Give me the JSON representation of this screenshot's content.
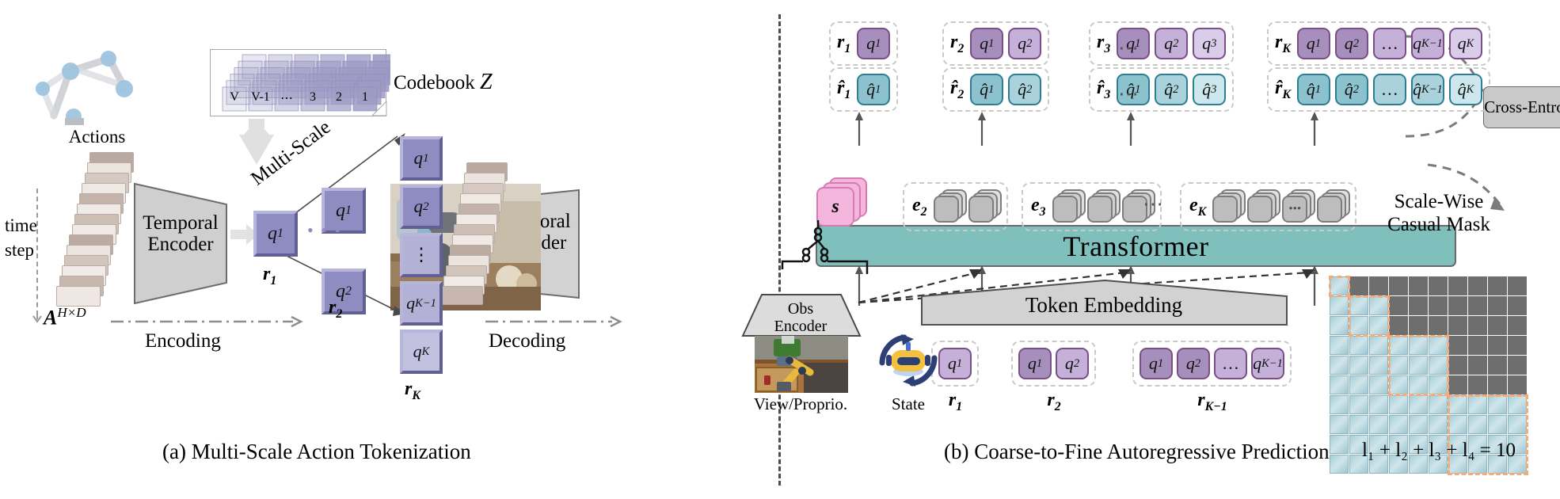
{
  "figure": {
    "caption_a": "(a) Multi-Scale Action Tokenization",
    "caption_b": "(b) Coarse-to-Fine Autoregressive Prediction"
  },
  "panel_a": {
    "actions_label": "Actions",
    "time_label": "time",
    "step_label": "step",
    "action_matrix": "A",
    "action_matrix_sup": "H×D",
    "encoder_line1": "Temporal",
    "encoder_line2": "Encoder",
    "decoder_line1": "Temporal",
    "decoder_line2": "Decoder",
    "encoding_label": "Encoding",
    "decoding_label": "Decoding",
    "multiscale_label": "Multi-Scale",
    "codebook_label": "Codebook",
    "codebook_symbol": "Z",
    "codebook_entries": [
      "V",
      "V-1",
      "⋯",
      "3",
      "2",
      "1"
    ],
    "residuals": [
      "r",
      "r",
      "r"
    ],
    "residual_subs": [
      "1",
      "2",
      "K"
    ],
    "tokens_col1": [
      "q1"
    ],
    "tokens_col2": [
      "q1",
      "q2"
    ],
    "tokens_col3": [
      "q1",
      "q2",
      "⋮",
      "qK-1",
      "qK"
    ],
    "q_base": "q",
    "q_sups": [
      "1",
      "2",
      "K−1",
      "K"
    ],
    "ellipsis": "• • •"
  },
  "panel_b": {
    "transformer_label": "Transformer",
    "cross_entropy_label": "Cross-Entropy",
    "token_embedding_label": "Token Embedding",
    "obs_encoder_line1": "Obs",
    "obs_encoder_line2": "Encoder",
    "view_proprio_label": "View/Proprio.",
    "state_label": "State",
    "state_token": "s",
    "mask_title_line1": "Scale-Wise",
    "mask_title_line2": "Casual Mask",
    "mask_equation": "l₁ + l₂ + l₃ + l₄ = 10",
    "target_rows": [
      {
        "label": "r",
        "sub": "1",
        "tokens": [
          {
            "base": "q",
            "sup": "1",
            "shade": 0
          }
        ]
      },
      {
        "label": "r",
        "sub": "2",
        "tokens": [
          {
            "base": "q",
            "sup": "1",
            "shade": 0
          },
          {
            "base": "q",
            "sup": "2",
            "shade": 1
          }
        ]
      },
      {
        "label": "r",
        "sub": "3",
        "tokens": [
          {
            "base": "q",
            "sup": "1",
            "shade": 0
          },
          {
            "base": "q",
            "sup": "2",
            "shade": 1
          },
          {
            "base": "q",
            "sup": "3",
            "shade": 2
          }
        ]
      },
      {
        "label": "r",
        "sub": "K",
        "tokens": [
          {
            "base": "q",
            "sup": "1",
            "shade": 0
          },
          {
            "base": "q",
            "sup": "2",
            "shade": 0
          },
          {
            "base": "…",
            "sup": "",
            "shade": 1
          },
          {
            "base": "q",
            "sup": "K−1",
            "shade": 1
          },
          {
            "base": "q",
            "sup": "K",
            "shade": 2
          }
        ]
      }
    ],
    "pred_rows": [
      {
        "label": "r̂",
        "sub": "1",
        "tokens": [
          {
            "base": "q̂",
            "sup": "1",
            "shade": 0
          }
        ]
      },
      {
        "label": "r̂",
        "sub": "2",
        "tokens": [
          {
            "base": "q̂",
            "sup": "1",
            "shade": 0
          },
          {
            "base": "q̂",
            "sup": "2",
            "shade": 1
          }
        ]
      },
      {
        "label": "r̂",
        "sub": "3",
        "tokens": [
          {
            "base": "q̂",
            "sup": "1",
            "shade": 0
          },
          {
            "base": "q̂",
            "sup": "2",
            "shade": 1
          },
          {
            "base": "q̂",
            "sup": "3",
            "shade": 2
          }
        ]
      },
      {
        "label": "r̂",
        "sub": "K",
        "tokens": [
          {
            "base": "q̂",
            "sup": "1",
            "shade": 0
          },
          {
            "base": "q̂",
            "sup": "2",
            "shade": 0
          },
          {
            "base": "…",
            "sup": "",
            "shade": 1
          },
          {
            "base": "q̂",
            "sup": "K−1",
            "shade": 1
          },
          {
            "base": "q̂",
            "sup": "K",
            "shade": 2
          }
        ]
      }
    ],
    "embed_groups": [
      {
        "label": "e",
        "sub": "2",
        "count": 2
      },
      {
        "label": "e",
        "sub": "3",
        "count": 3
      },
      {
        "label": "e",
        "sub": "K",
        "count": 4
      }
    ],
    "input_rows": [
      {
        "label": "r",
        "sub": "1",
        "tokens": [
          {
            "base": "q",
            "sup": "1",
            "shade": 1
          }
        ]
      },
      {
        "label": "r",
        "sub": "2",
        "tokens": [
          {
            "base": "q",
            "sup": "1",
            "shade": 0
          },
          {
            "base": "q",
            "sup": "2",
            "shade": 1
          }
        ]
      },
      {
        "label": "r",
        "sub": "K−1",
        "tokens": [
          {
            "base": "q",
            "sup": "1",
            "shade": 0
          },
          {
            "base": "q",
            "sup": "2",
            "shade": 0
          },
          {
            "base": "…",
            "sup": "",
            "shade": 1
          },
          {
            "base": "q",
            "sup": "K−1",
            "shade": 1
          }
        ]
      }
    ],
    "ellipsis": "⋯"
  },
  "colors": {
    "transformer": "#7fc0bd",
    "state_token": "#f5b6dd",
    "target_token": "#c4b0d8",
    "pred_token": "#a9d2dc",
    "mask_on": "#a8cfd8",
    "mask_off": "#6e6e6e",
    "mask_highlight": "#f6ab77",
    "codebook": "#9d9ac4",
    "q_tile": "#8e8cc0"
  },
  "chart_data": {
    "type": "heatmap",
    "title": "Scale-Wise Casual Mask",
    "rows": 10,
    "cols": 10,
    "block_sizes": [
      1,
      2,
      3,
      4
    ],
    "note": "l1 + l2 + l3 + l4 = 10",
    "values": [
      [
        1,
        0,
        0,
        0,
        0,
        0,
        0,
        0,
        0,
        0
      ],
      [
        1,
        1,
        1,
        0,
        0,
        0,
        0,
        0,
        0,
        0
      ],
      [
        1,
        1,
        1,
        0,
        0,
        0,
        0,
        0,
        0,
        0
      ],
      [
        1,
        1,
        1,
        1,
        1,
        1,
        0,
        0,
        0,
        0
      ],
      [
        1,
        1,
        1,
        1,
        1,
        1,
        0,
        0,
        0,
        0
      ],
      [
        1,
        1,
        1,
        1,
        1,
        1,
        0,
        0,
        0,
        0
      ],
      [
        1,
        1,
        1,
        1,
        1,
        1,
        1,
        1,
        1,
        1
      ],
      [
        1,
        1,
        1,
        1,
        1,
        1,
        1,
        1,
        1,
        1
      ],
      [
        1,
        1,
        1,
        1,
        1,
        1,
        1,
        1,
        1,
        1
      ],
      [
        1,
        1,
        1,
        1,
        1,
        1,
        1,
        1,
        1,
        1
      ]
    ]
  }
}
